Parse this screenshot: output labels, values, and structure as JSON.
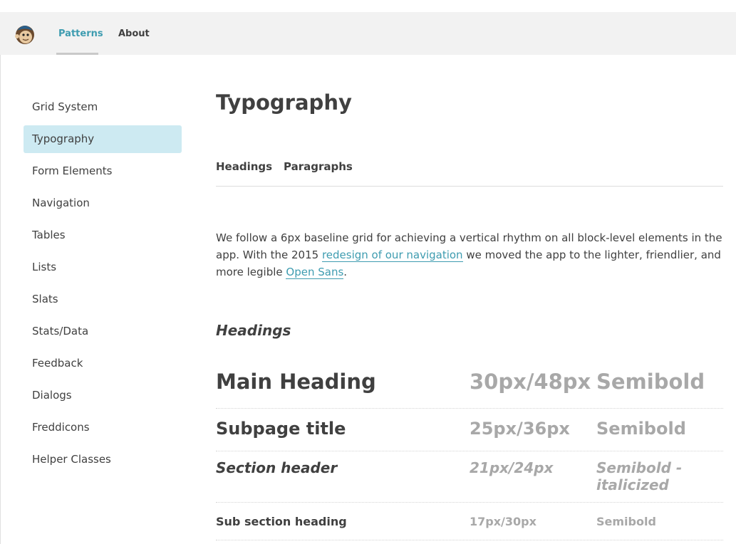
{
  "topnav": {
    "links": [
      {
        "label": "Patterns",
        "active": true
      },
      {
        "label": "About",
        "active": false
      }
    ],
    "logo_icon": "freddie-monkey-logo-icon"
  },
  "sidebar": {
    "items": [
      {
        "label": "Grid System"
      },
      {
        "label": "Typography",
        "selected": true
      },
      {
        "label": "Form Elements"
      },
      {
        "label": "Navigation"
      },
      {
        "label": "Tables"
      },
      {
        "label": "Lists"
      },
      {
        "label": "Slats"
      },
      {
        "label": "Stats/Data"
      },
      {
        "label": "Feedback"
      },
      {
        "label": "Dialogs"
      },
      {
        "label": "Freddicons"
      },
      {
        "label": "Helper Classes"
      }
    ]
  },
  "main": {
    "title": "Typography",
    "tabs": [
      {
        "label": "Headings"
      },
      {
        "label": "Paragraphs"
      }
    ],
    "intro": {
      "part1": "We follow a 6px baseline grid for achieving a vertical rhythm on all block-level elements in the app. With the 2015 ",
      "link1": "redesign of our navigation",
      "part2": " we moved the app to the lighter, friendlier, and more legible ",
      "link2": "Open Sans",
      "part3": "."
    },
    "section_heading": "Headings",
    "heading_rows": [
      {
        "name": "Main Heading",
        "size": "30px/48px",
        "weight": "Semibold"
      },
      {
        "name": "Subpage title",
        "size": "25px/36px",
        "weight": "Semibold"
      },
      {
        "name": "Section header",
        "size": "21px/24px",
        "weight": "Semibold - italicized"
      },
      {
        "name": "Sub section heading",
        "size": "17px/30px",
        "weight": "Semibold"
      }
    ]
  },
  "colors": {
    "accent": "#3e9cb0",
    "selected_bg": "#cdeaf2",
    "topbar_bg": "#f2f2f2",
    "muted_text": "#a8a8a8"
  }
}
